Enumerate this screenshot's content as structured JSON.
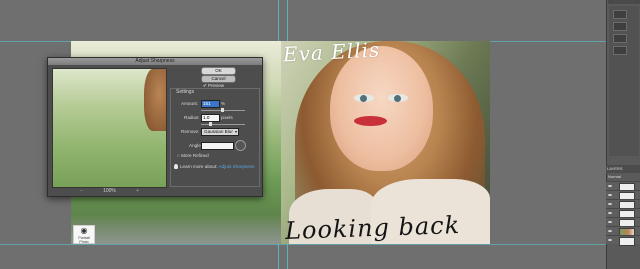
{
  "canvas": {
    "signature_top": "Eva Ellis",
    "signature_bottom": "Looking back",
    "stamp_text": "Portrait Photo"
  },
  "dialog": {
    "title": "Adjust Sharpness",
    "ok_label": "OK",
    "cancel_label": "Cancel",
    "preview_label": "Preview",
    "preview_checked": true,
    "zoom_level": "100%",
    "settings_label": "Settings",
    "amount_label": "Amount:",
    "amount_value": "151",
    "amount_unit": "%",
    "radius_label": "Radius:",
    "radius_value": "1.0",
    "radius_unit": "pixels",
    "remove_label": "Remove:",
    "remove_value": "Gaussian Blur",
    "angle_label": "Angle:",
    "more_refined_label": "More Refined",
    "learn_more_label": "Learn more about:",
    "learn_more_link": "Adjust Sharpness"
  },
  "panels": {
    "layers_tab": "LAYERS",
    "layers_subtitle": "Normal"
  }
}
